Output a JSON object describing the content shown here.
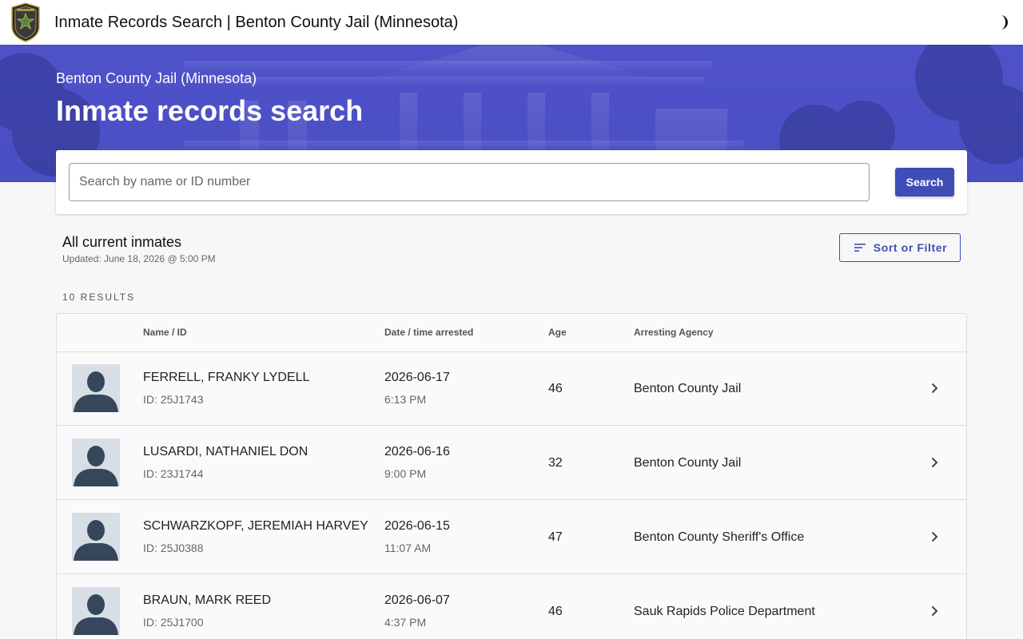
{
  "app": {
    "title": "Inmate Records Search | Benton County Jail (Minnesota)",
    "badge_icon": "sheriff-badge-icon",
    "theme_icon": "half-moon-icon"
  },
  "hero": {
    "subtitle": "Benton County Jail (Minnesota)",
    "title": "Inmate records search"
  },
  "search": {
    "placeholder": "Search by name or ID number",
    "value": "",
    "button_label": "Search"
  },
  "section": {
    "title": "All current inmates",
    "updated": "Updated: June 18, 2026 @ 5:00 PM",
    "sort_label": "Sort or Filter",
    "results_count": "10 RESULTS"
  },
  "table": {
    "headers": {
      "name_id": "Name / ID",
      "date_time": "Date / time arrested",
      "age": "Age",
      "agency": "Arresting Agency"
    },
    "rows": [
      {
        "name": "FERRELL, FRANKY LYDELL",
        "id": "ID: 25J1743",
        "date": "2026-06-17",
        "time": "6:13 PM",
        "age": "46",
        "agency": "Benton County Jail"
      },
      {
        "name": "LUSARDI, NATHANIEL DON",
        "id": "ID: 23J1744",
        "date": "2026-06-16",
        "time": "9:00 PM",
        "age": "32",
        "agency": "Benton County Jail"
      },
      {
        "name": "SCHWARZKOPF, JEREMIAH HARVEY",
        "id": "ID: 25J0388",
        "date": "2026-06-15",
        "time": "11:07 AM",
        "age": "47",
        "agency": "Benton County Sheriff's Office"
      },
      {
        "name": "BRAUN, MARK REED",
        "id": "ID: 25J1700",
        "date": "2026-06-07",
        "time": "4:37 PM",
        "age": "46",
        "agency": "Sauk Rapids Police Department"
      }
    ]
  },
  "colors": {
    "primary": "#3f4db7",
    "hero": "#4f52c9",
    "avatar_bg": "#d7dee6",
    "avatar_fg": "#36475c"
  }
}
